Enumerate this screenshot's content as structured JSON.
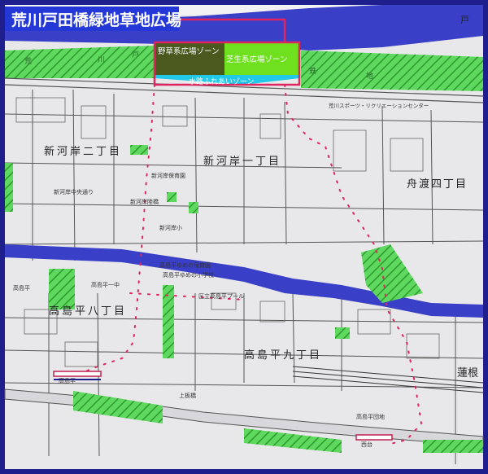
{
  "map": {
    "title": "荒川戸田橋緑地草地広場",
    "zones": {
      "wild": "野草系広場ゾーン",
      "lawn": "芝生系広場ゾーン",
      "water": "水路ふれあいゾーン"
    },
    "districts": [
      "新河岸二丁目",
      "新河岸一丁目",
      "舟渡四丁目",
      "高島平八丁目",
      "高島平九丁目",
      "蓮根"
    ],
    "street_labels": [
      "新河岸中央通り",
      "新河岸保育園",
      "新河岸小",
      "荒川スポーツ・リクリエーションセンター",
      "高島平",
      "高島平ゆめの保育園",
      "高島平ゆめの小学校",
      "区立高島平プール",
      "高島平一中",
      "上板橋",
      "戸",
      "荒",
      "川",
      "戸",
      "鉄",
      "地",
      "西台",
      "高島平",
      "新河岸陸橋",
      "高島平団地"
    ],
    "colors": {
      "frame": "#1e1f8c",
      "river": "#3a3fc8",
      "park": "#4fd14f",
      "route": "#e0245e",
      "wild_zone": "#4a5a1e",
      "lawn_zone": "#6ee01e",
      "water_zone": "#22c8e8",
      "title_bar": "#2438d8"
    }
  }
}
